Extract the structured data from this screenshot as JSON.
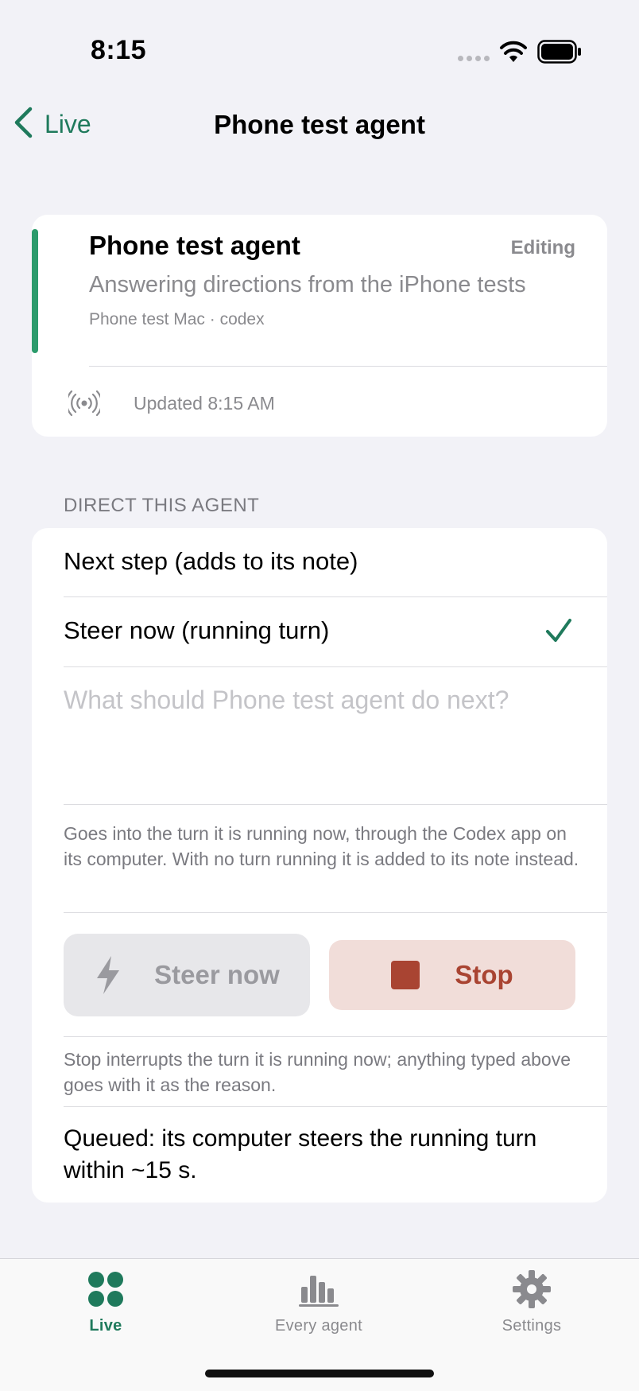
{
  "status_bar": {
    "time": "8:15"
  },
  "nav": {
    "back_label": "Live",
    "title": "Phone test agent"
  },
  "agent_card": {
    "name": "Phone test agent",
    "state": "Editing",
    "description": "Answering directions from the iPhone tests",
    "meta": "Phone test Mac · codex",
    "updated": "Updated 8:15 AM",
    "accent_color": "#2c9b6c"
  },
  "direct": {
    "section_header": "DIRECT THIS AGENT",
    "options": [
      {
        "label": "Next step (adds to its note)",
        "selected": false
      },
      {
        "label": "Steer now (running turn)",
        "selected": true
      }
    ],
    "input_placeholder": "What should Phone test agent do next?",
    "help_text": "Goes into the turn it is running now, through the Codex app on its computer. With no turn running it is added to its note instead.",
    "steer_button": "Steer now",
    "stop_button": "Stop",
    "stop_help": "Stop interrupts the turn it is running now; anything typed above goes with it as the reason.",
    "queued_text": "Queued: its computer steers the running turn within ~15 s."
  },
  "tabs": [
    {
      "label": "Live",
      "icon": "grid-dots-icon",
      "active": true
    },
    {
      "label": "Every agent",
      "icon": "bar-chart-icon",
      "active": false
    },
    {
      "label": "Settings",
      "icon": "gear-icon",
      "active": false
    }
  ],
  "colors": {
    "accent": "#1f7a5c",
    "stop": "#a94432"
  }
}
